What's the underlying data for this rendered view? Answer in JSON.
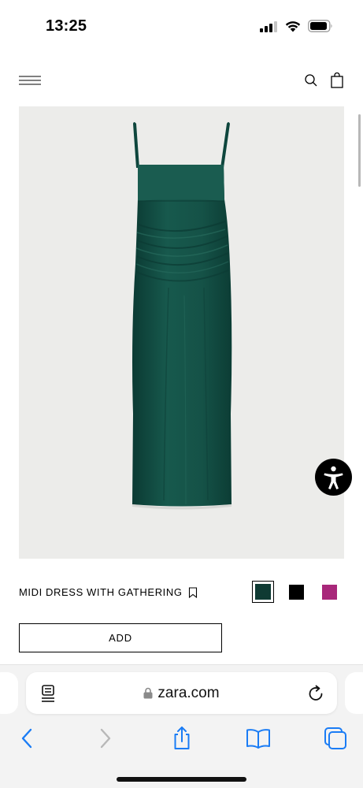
{
  "status_bar": {
    "time": "13:25"
  },
  "header": {
    "menu_icon": "hamburger-menu-icon",
    "search_icon": "search-icon",
    "bag_icon": "shopping-bag-icon"
  },
  "product": {
    "name": "MIDI DRESS WITH GATHERING",
    "add_label": "ADD",
    "colors": [
      {
        "name": "dark-green",
        "hex": "#0f3a33",
        "selected": true
      },
      {
        "name": "black",
        "hex": "#000000",
        "selected": false
      },
      {
        "name": "magenta",
        "hex": "#a8277a",
        "selected": false
      }
    ],
    "dress_color": "#14554a"
  },
  "browser": {
    "url": "zara.com"
  }
}
